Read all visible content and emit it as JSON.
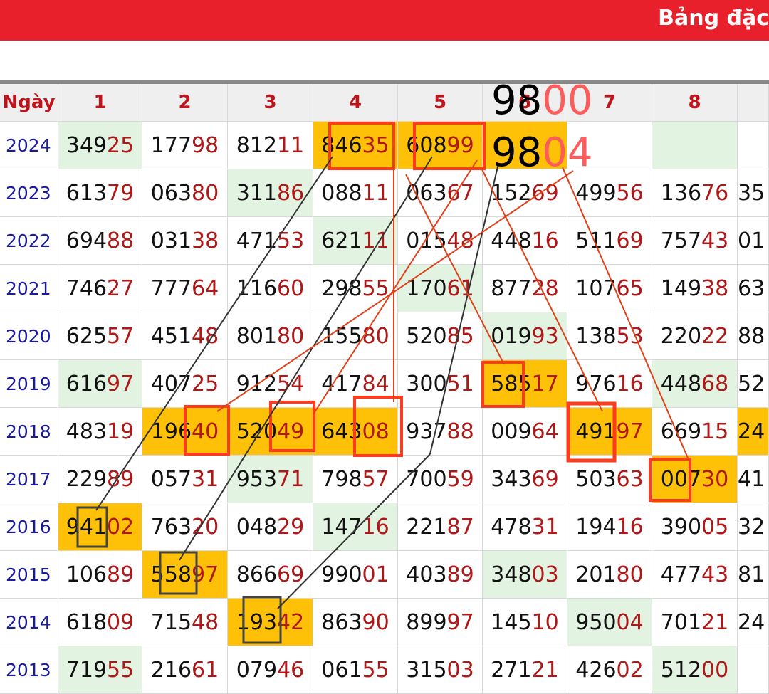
{
  "header": {
    "title": "Bảng đặc"
  },
  "table": {
    "columns": [
      "Ngày",
      "1",
      "2",
      "3",
      "4",
      "5",
      "6",
      "7",
      "8"
    ],
    "rows": [
      {
        "year": "2024",
        "cells": [
          "34925",
          "17798",
          "81211",
          "84635",
          "60899",
          "",
          "",
          ""
        ]
      },
      {
        "year": "2023",
        "cells": [
          "61379",
          "06380",
          "31186",
          "08811",
          "06367",
          "15269",
          "49956",
          "13676",
          "35"
        ]
      },
      {
        "year": "2022",
        "cells": [
          "69488",
          "03138",
          "47153",
          "62111",
          "01548",
          "44816",
          "51169",
          "75743",
          "01"
        ]
      },
      {
        "year": "2021",
        "cells": [
          "74627",
          "77764",
          "11660",
          "29855",
          "17061",
          "87728",
          "10765",
          "14938",
          "63"
        ]
      },
      {
        "year": "2020",
        "cells": [
          "62557",
          "45148",
          "80180",
          "15580",
          "52085",
          "01993",
          "13853",
          "22022",
          "88"
        ]
      },
      {
        "year": "2019",
        "cells": [
          "61697",
          "40725",
          "91254",
          "41784",
          "30051",
          "58517",
          "97616",
          "44868",
          "52"
        ]
      },
      {
        "year": "2018",
        "cells": [
          "48319",
          "19640",
          "52049",
          "64308",
          "93788",
          "00964",
          "49197",
          "66915",
          "24"
        ]
      },
      {
        "year": "2017",
        "cells": [
          "22989",
          "05731",
          "95371",
          "79857",
          "70059",
          "34369",
          "50363",
          "00730",
          "41"
        ]
      },
      {
        "year": "2016",
        "cells": [
          "94102",
          "76320",
          "04829",
          "14716",
          "22187",
          "47831",
          "19416",
          "39005",
          "32"
        ]
      },
      {
        "year": "2015",
        "cells": [
          "10689",
          "55897",
          "86669",
          "99001",
          "40389",
          "34803",
          "20180",
          "47743",
          "81"
        ]
      },
      {
        "year": "2014",
        "cells": [
          "61809",
          "71548",
          "19342",
          "86390",
          "89997",
          "14510",
          "95004",
          "70121",
          "24"
        ]
      },
      {
        "year": "2013",
        "cells": [
          "71955",
          "21661",
          "07946",
          "06155",
          "31503",
          "27121",
          "42602",
          "51200",
          ""
        ]
      }
    ]
  },
  "annotation": {
    "line1_black": "98",
    "line1_red": "00",
    "line2_black": "98",
    "line2_red": "04"
  },
  "colors": {
    "header_red": "#e8202b",
    "highlight_gold": "#ffc107",
    "highlight_green": "#e2f3e2",
    "box_red": "#ff3b1f",
    "box_dark": "#444444",
    "line_red": "#e0401a",
    "line_dark": "#333333"
  }
}
